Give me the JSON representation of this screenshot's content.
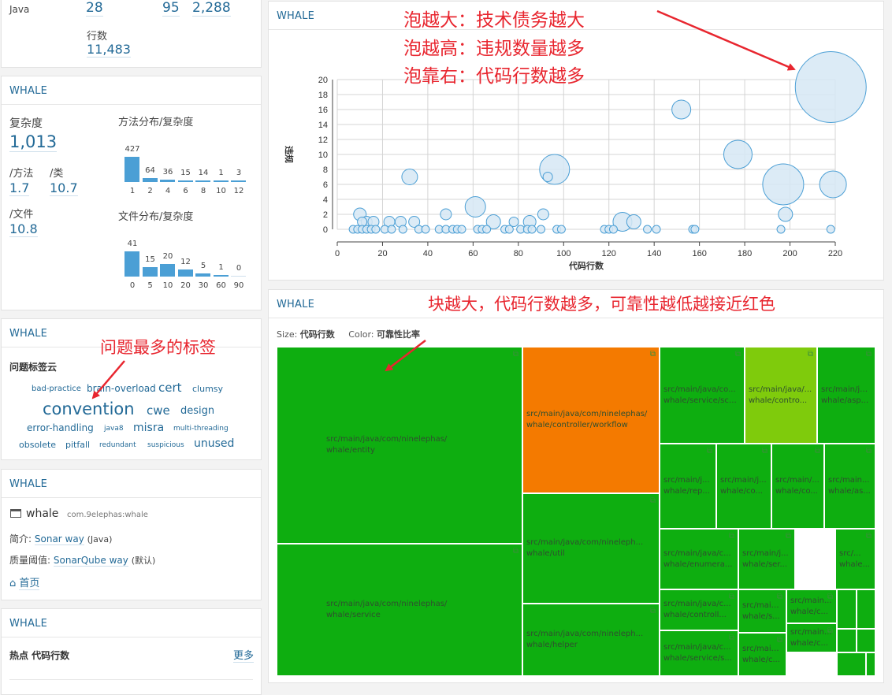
{
  "top_panel": {
    "language": "Java",
    "values": [
      "28",
      "95",
      "2,288"
    ],
    "lines_label": "行数",
    "lines_value": "11,483"
  },
  "complexity_panel": {
    "title": "WHALE",
    "complexity_label": "复杂度",
    "complexity_value": "1,013",
    "per_method_label": "/方法",
    "per_method_value": "1.7",
    "per_class_label": "/类",
    "per_class_value": "10.7",
    "per_file_label": "/文件",
    "per_file_value": "10.8",
    "method_dist": {
      "title": "方法分布/复杂度",
      "counts": [
        "427",
        "64",
        "36",
        "15",
        "14",
        "1",
        "3"
      ],
      "count_values": [
        427,
        64,
        36,
        15,
        14,
        1,
        3
      ],
      "buckets": [
        "1",
        "2",
        "4",
        "6",
        "8",
        "10",
        "12"
      ]
    },
    "file_dist": {
      "title": "文件分布/复杂度",
      "counts": [
        "41",
        "15",
        "20",
        "12",
        "5",
        "1",
        "0"
      ],
      "count_values": [
        41,
        15,
        20,
        12,
        5,
        1,
        0
      ],
      "buckets": [
        "0",
        "5",
        "10",
        "20",
        "30",
        "60",
        "90"
      ]
    }
  },
  "tags_panel": {
    "title": "WHALE",
    "heading": "问题标签云",
    "tags": [
      "bad-practice",
      "brain-overload",
      "cert",
      "clumsy",
      "convention",
      "cwe",
      "design",
      "error-handling",
      "java8",
      "misra",
      "multi-threading",
      "obsolete",
      "pitfall",
      "redundant",
      "suspicious",
      "unused"
    ]
  },
  "project_panel": {
    "title": "WHALE",
    "project_name": "whale",
    "project_key": "com.9elephas:whale",
    "profile_label": "简介:",
    "profile_link": "Sonar way",
    "profile_lang": "(Java)",
    "gate_label": "质量阈值:",
    "gate_link": "SonarQube way",
    "gate_default": "(默认)",
    "home_link": "首页"
  },
  "hotspot_panel": {
    "title": "WHALE",
    "heading": "热点 代码行数",
    "more_link": "更多"
  },
  "bubble_panel": {
    "title": "WHALE"
  },
  "chart_data": {
    "type": "scatter",
    "xlabel": "代码行数",
    "ylabel": "违规",
    "xlim": [
      0,
      220
    ],
    "ylim": [
      0,
      20
    ],
    "xticks": [
      0,
      20,
      40,
      60,
      80,
      100,
      120,
      140,
      160,
      180,
      200,
      220
    ],
    "yticks": [
      0,
      2,
      4,
      6,
      8,
      10,
      12,
      14,
      16,
      18,
      20
    ],
    "grid": true,
    "points": [
      {
        "x": 218,
        "y": 19,
        "size": 45
      },
      {
        "x": 152,
        "y": 16,
        "size": 12
      },
      {
        "x": 177,
        "y": 10,
        "size": 18
      },
      {
        "x": 96,
        "y": 8,
        "size": 19
      },
      {
        "x": 93,
        "y": 7,
        "size": 6
      },
      {
        "x": 32,
        "y": 7,
        "size": 10
      },
      {
        "x": 197,
        "y": 6,
        "size": 26
      },
      {
        "x": 219,
        "y": 6,
        "size": 17
      },
      {
        "x": 61,
        "y": 3,
        "size": 13
      },
      {
        "x": 126,
        "y": 1,
        "size": 12
      },
      {
        "x": 131,
        "y": 1,
        "size": 9
      },
      {
        "x": 198,
        "y": 2,
        "size": 9
      },
      {
        "x": 10,
        "y": 2,
        "size": 8
      },
      {
        "x": 48,
        "y": 2,
        "size": 7
      },
      {
        "x": 91,
        "y": 2,
        "size": 7
      },
      {
        "x": 69,
        "y": 1,
        "size": 9
      },
      {
        "x": 85,
        "y": 1,
        "size": 8
      },
      {
        "x": 23,
        "y": 1,
        "size": 7
      },
      {
        "x": 28,
        "y": 1,
        "size": 7
      },
      {
        "x": 34,
        "y": 1,
        "size": 7
      },
      {
        "x": 13,
        "y": 1,
        "size": 7
      },
      {
        "x": 16,
        "y": 1,
        "size": 7
      },
      {
        "x": 78,
        "y": 1,
        "size": 6
      },
      {
        "x": 11,
        "y": 1,
        "size": 6
      },
      {
        "x": 7,
        "y": 0,
        "size": 5
      },
      {
        "x": 9,
        "y": 0,
        "size": 5
      },
      {
        "x": 11,
        "y": 0,
        "size": 5
      },
      {
        "x": 13,
        "y": 0,
        "size": 5
      },
      {
        "x": 15,
        "y": 0,
        "size": 5
      },
      {
        "x": 17,
        "y": 0,
        "size": 5
      },
      {
        "x": 21,
        "y": 0,
        "size": 5
      },
      {
        "x": 24,
        "y": 0,
        "size": 5
      },
      {
        "x": 29,
        "y": 0,
        "size": 5
      },
      {
        "x": 36,
        "y": 0,
        "size": 5
      },
      {
        "x": 39,
        "y": 0,
        "size": 5
      },
      {
        "x": 45,
        "y": 0,
        "size": 5
      },
      {
        "x": 48,
        "y": 0,
        "size": 5
      },
      {
        "x": 51,
        "y": 0,
        "size": 5
      },
      {
        "x": 53,
        "y": 0,
        "size": 5
      },
      {
        "x": 55,
        "y": 0,
        "size": 5
      },
      {
        "x": 62,
        "y": 0,
        "size": 5
      },
      {
        "x": 64,
        "y": 0,
        "size": 5
      },
      {
        "x": 66,
        "y": 0,
        "size": 5
      },
      {
        "x": 74,
        "y": 0,
        "size": 5
      },
      {
        "x": 76,
        "y": 0,
        "size": 5
      },
      {
        "x": 81,
        "y": 0,
        "size": 5
      },
      {
        "x": 84,
        "y": 0,
        "size": 5
      },
      {
        "x": 86,
        "y": 0,
        "size": 5
      },
      {
        "x": 90,
        "y": 0,
        "size": 5
      },
      {
        "x": 97,
        "y": 0,
        "size": 5
      },
      {
        "x": 99,
        "y": 0,
        "size": 5
      },
      {
        "x": 118,
        "y": 0,
        "size": 5
      },
      {
        "x": 120,
        "y": 0,
        "size": 5
      },
      {
        "x": 122,
        "y": 0,
        "size": 5
      },
      {
        "x": 137,
        "y": 0,
        "size": 5
      },
      {
        "x": 141,
        "y": 0,
        "size": 5
      },
      {
        "x": 157,
        "y": 0,
        "size": 5
      },
      {
        "x": 158,
        "y": 0,
        "size": 5
      },
      {
        "x": 196,
        "y": 0,
        "size": 5
      },
      {
        "x": 218,
        "y": 0,
        "size": 5
      }
    ],
    "colors": {
      "fill": "#d6e8f5",
      "stroke": "#4b9fd5"
    }
  },
  "annotations": {
    "bubble_note_1": "泡越大：技术债务越大",
    "bubble_note_2": "泡越高：违规数量越多",
    "bubble_note_3": "泡靠右：代码行数越多",
    "treemap_note": "块越大，代码行数越多，可靠性越低越接近红色",
    "tags_note": "问题最多的标签"
  },
  "treemap_panel": {
    "title": "WHALE",
    "size_label": "Size:",
    "size_value": "代码行数",
    "color_label": "Color:",
    "color_value": "可靠性比率",
    "colors": {
      "green": "#0eae10",
      "orange": "#f47a00",
      "lime": "#7fcb0c"
    },
    "cells": [
      {
        "l1": "src/main/java/com/ninelephas/",
        "l2": "whale/entity",
        "color": "green"
      },
      {
        "l1": "src/main/java/com/ninelephas/",
        "l2": "whale/service",
        "color": "green"
      },
      {
        "l1": "src/main/java/com/ninelephas/",
        "l2": "whale/controller/workflow",
        "color": "orange"
      },
      {
        "l1": "src/main/java/com/nineleph...",
        "l2": "whale/util",
        "color": "green"
      },
      {
        "l1": "src/main/java/com/nineleph...",
        "l2": "whale/helper",
        "color": "green"
      },
      {
        "l1": "src/main/java/co...",
        "l2": "whale/service/sch...",
        "color": "green"
      },
      {
        "l1": "src/main/java/...",
        "l2": "whale/contro...",
        "color": "lime"
      },
      {
        "l1": "src/main/ja...",
        "l2": "whale/asp...",
        "color": "green"
      },
      {
        "l1": "src/main/j...",
        "l2": "whale/rep...",
        "color": "green"
      },
      {
        "l1": "src/main/j...",
        "l2": "whale/co...",
        "color": "green"
      },
      {
        "l1": "src/main/...",
        "l2": "whale/co...",
        "color": "green"
      },
      {
        "l1": "src/main...",
        "l2": "whale/as...",
        "color": "green"
      },
      {
        "l1": "src/main/java/c...",
        "l2": "whale/enumera...",
        "color": "green"
      },
      {
        "l1": "src/main/j...",
        "l2": "whale/ser...",
        "color": "green"
      },
      {
        "l1": "src/...",
        "l2": "whale...",
        "color": "green"
      },
      {
        "l1": "src/main/java/c...",
        "l2": "whale/controll...",
        "color": "green"
      },
      {
        "l1": "src/main...",
        "l2": "whale/s...",
        "color": "green"
      },
      {
        "l1": "src/main...",
        "l2": "whale/c...",
        "color": "green"
      },
      {
        "l1": "src/main/java/c...",
        "l2": "whale/service/s...",
        "color": "green"
      },
      {
        "l1": "src/main...",
        "l2": "whale/c...",
        "color": "green"
      },
      {
        "l1": "src/main...",
        "l2": "whale/c...",
        "color": "green"
      }
    ]
  }
}
